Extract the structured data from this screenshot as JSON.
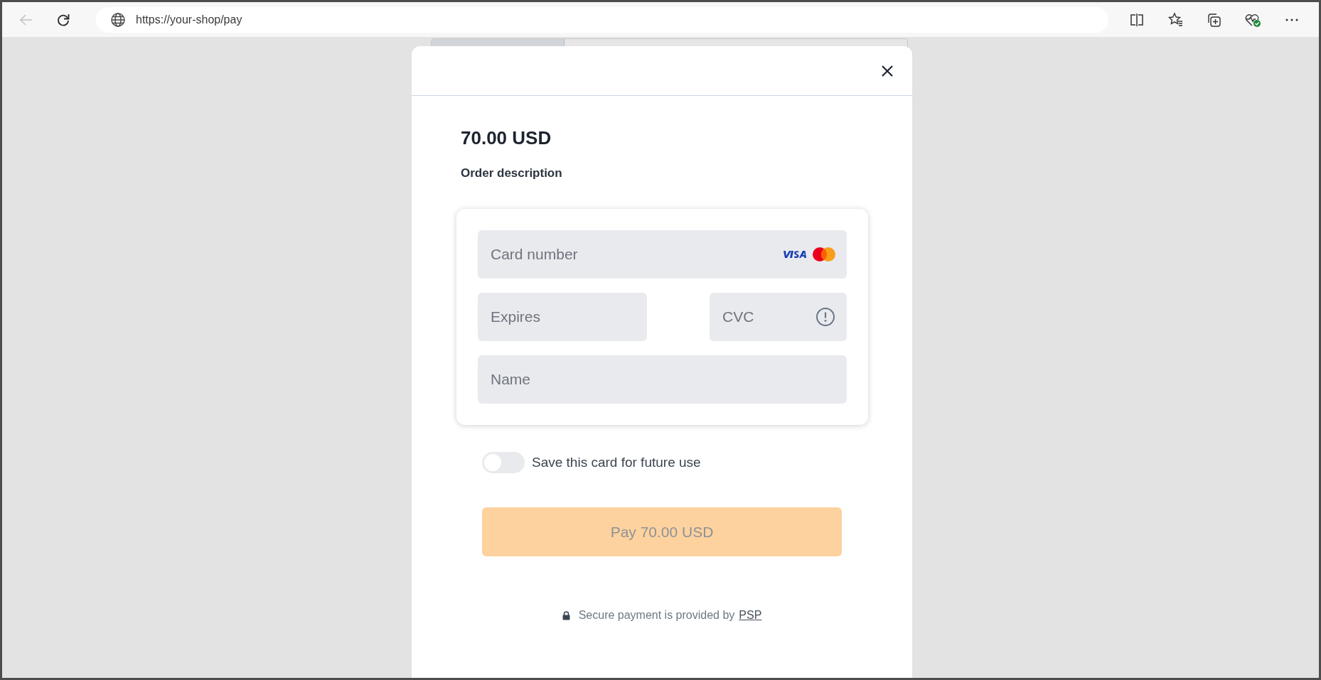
{
  "browser": {
    "url": "https://your-shop/pay",
    "back_button": {
      "disabled": true
    }
  },
  "modal": {
    "amount": "70.00 USD",
    "description": "Order description",
    "fields": [
      {
        "kind": "card_number",
        "placeholder": "Card number"
      },
      {
        "kind": "expiry",
        "placeholder": "Expires"
      },
      {
        "kind": "cvc",
        "placeholder": "CVC"
      },
      {
        "kind": "name",
        "placeholder": "Name"
      }
    ],
    "save_card": {
      "label": "Save this card for future use",
      "on": false
    },
    "pay_button": {
      "label": "Pay 70.00 USD",
      "disabled": true
    },
    "footer": {
      "text": "Secure payment is provided by",
      "link": "PSP"
    }
  }
}
